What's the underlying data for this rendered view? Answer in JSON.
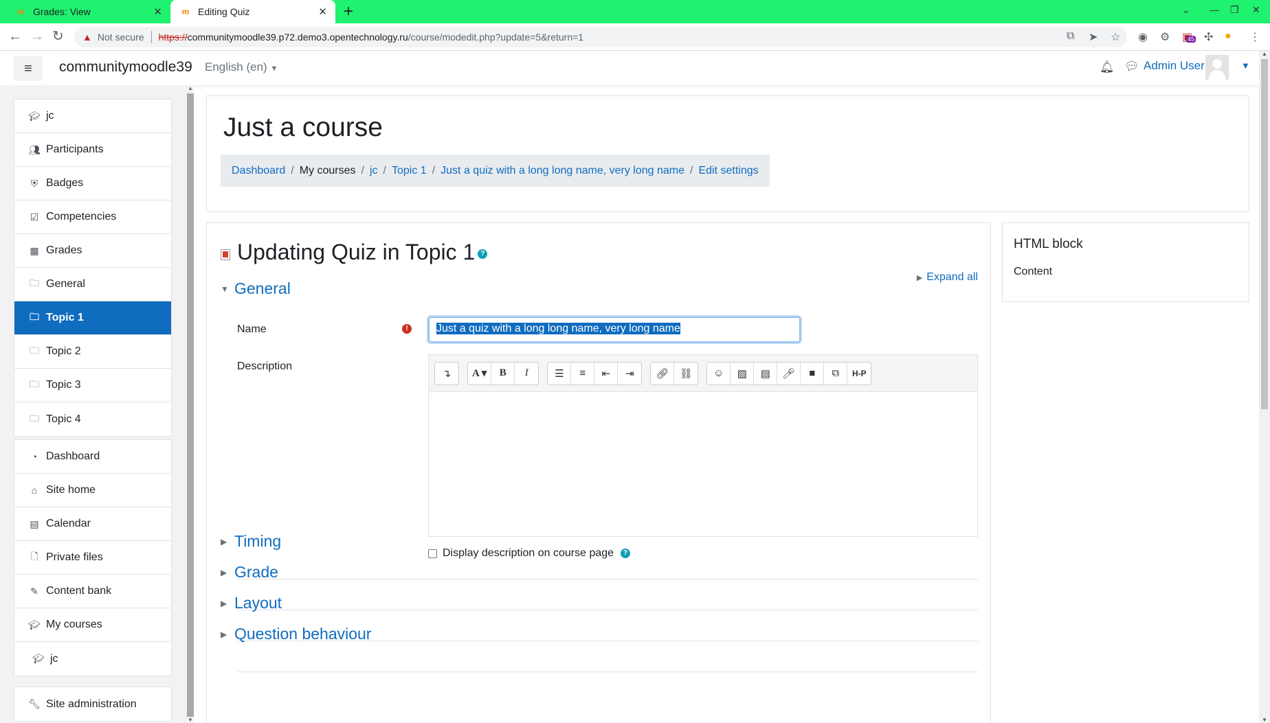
{
  "browser": {
    "tabs": [
      {
        "title": "Grades: View",
        "active": false
      },
      {
        "title": "Editing Quiz",
        "active": true
      }
    ],
    "new_tab": "+",
    "address": {
      "warning": "Not secure",
      "scheme": "https://",
      "host": "communitymoodle39.p72.demo3.opentechnology.ru",
      "path": "/course/modedit.php?update=5&return=1"
    },
    "extension_badge": "45",
    "accent_color": "#1ef26f"
  },
  "navbar": {
    "site_name": "communitymoodle39",
    "language": "English (en)",
    "user_name": "Admin User"
  },
  "drawer": {
    "course_nav": [
      {
        "label": "jc",
        "icon": "graduation-cap-icon"
      },
      {
        "label": "Participants",
        "icon": "users-icon"
      },
      {
        "label": "Badges",
        "icon": "shield-icon"
      },
      {
        "label": "Competencies",
        "icon": "checkbox-icon"
      },
      {
        "label": "Grades",
        "icon": "table-icon"
      },
      {
        "label": "General",
        "icon": "folder-icon"
      },
      {
        "label": "Topic 1",
        "icon": "folder-icon",
        "active": true
      },
      {
        "label": "Topic 2",
        "icon": "folder-icon"
      },
      {
        "label": "Topic 3",
        "icon": "folder-icon"
      },
      {
        "label": "Topic 4",
        "icon": "folder-icon"
      }
    ],
    "site_nav": [
      {
        "label": "Dashboard",
        "icon": "dashboard-icon"
      },
      {
        "label": "Site home",
        "icon": "home-icon"
      },
      {
        "label": "Calendar",
        "icon": "calendar-icon"
      },
      {
        "label": "Private files",
        "icon": "file-icon"
      },
      {
        "label": "Content bank",
        "icon": "brush-icon"
      },
      {
        "label": "My courses",
        "icon": "graduation-cap-icon"
      },
      {
        "label": "jc",
        "icon": "graduation-cap-icon"
      }
    ],
    "admin_nav": [
      {
        "label": "Site administration",
        "icon": "wrench-icon"
      }
    ]
  },
  "header": {
    "course_title": "Just a course",
    "breadcrumb": [
      "Dashboard",
      "My courses",
      "jc",
      "Topic 1",
      "Just a quiz with a long long name, very long name",
      "Edit settings"
    ]
  },
  "form": {
    "heading": "Updating Quiz in Topic 1",
    "expand_all": "Expand all",
    "general_section": "General",
    "name_label": "Name",
    "name_value": "Just a quiz with a long long name, very long name",
    "description_label": "Description",
    "display_description_label": "Display description on course page",
    "collapsed_sections": [
      "Timing",
      "Grade",
      "Layout",
      "Question behaviour"
    ]
  },
  "block": {
    "title": "HTML block",
    "content": "Content"
  }
}
